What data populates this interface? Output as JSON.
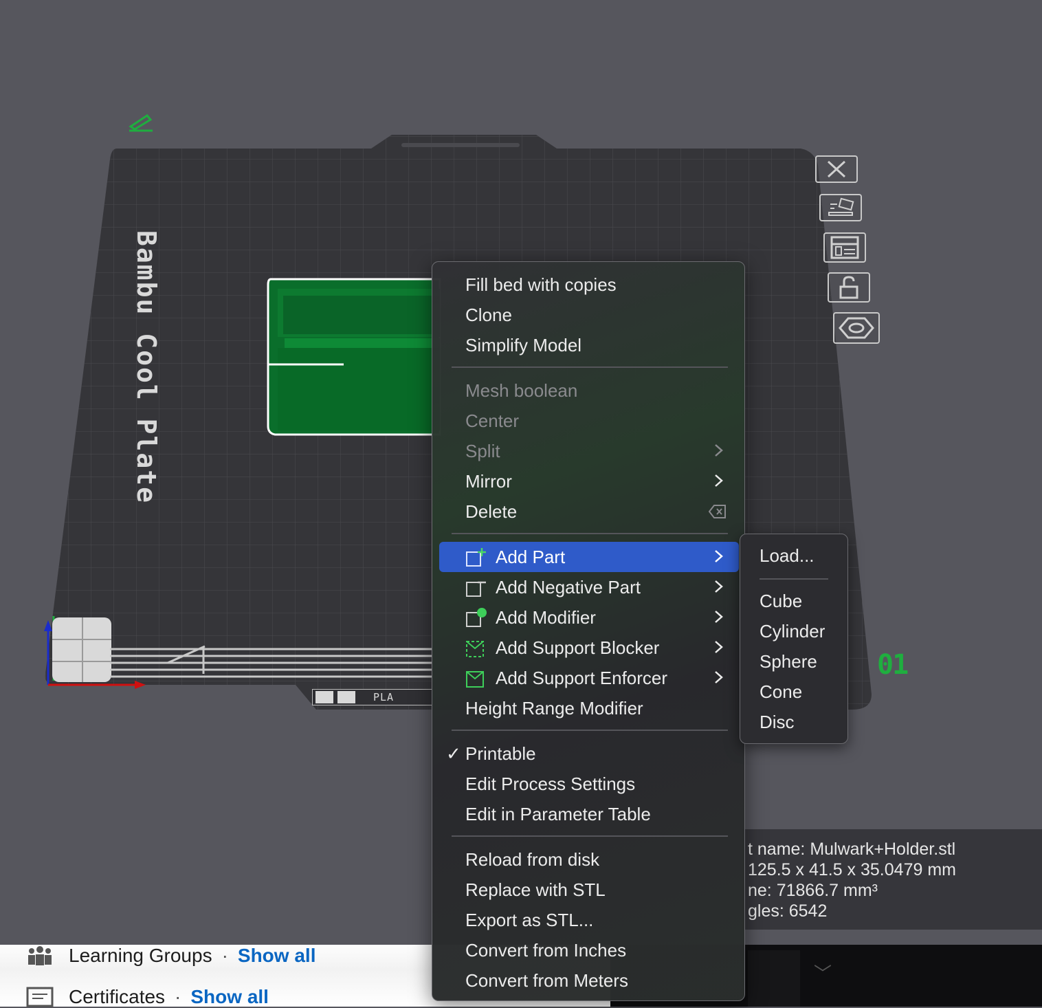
{
  "plate": {
    "label": "Bambu Cool Plate",
    "number": "01",
    "filament_tag": "PLA"
  },
  "info_panel": {
    "lines": [
      "t name: Mulwark+Holder.stl",
      "125.5 x 41.5 x 35.0479 mm",
      "ne: 71866.7 mm³",
      "gles: 6542"
    ]
  },
  "context_menu": {
    "items": [
      {
        "label": "Fill bed with copies"
      },
      {
        "label": "Clone"
      },
      {
        "label": "Simplify Model"
      },
      {
        "label": "Mesh boolean",
        "disabled": true
      },
      {
        "label": "Center",
        "disabled": true
      },
      {
        "label": "Split",
        "disabled": true,
        "submenu": true
      },
      {
        "label": "Mirror",
        "submenu": true
      },
      {
        "label": "Delete"
      },
      {
        "label": "Add Part",
        "submenu": true,
        "active": true
      },
      {
        "label": "Add Negative Part",
        "submenu": true
      },
      {
        "label": "Add Modifier",
        "submenu": true
      },
      {
        "label": "Add Support Blocker",
        "submenu": true
      },
      {
        "label": "Add Support Enforcer",
        "submenu": true
      },
      {
        "label": "Height Range Modifier"
      },
      {
        "label": "Printable",
        "checked": true
      },
      {
        "label": "Edit Process Settings"
      },
      {
        "label": "Edit in Parameter Table"
      },
      {
        "label": "Reload from disk"
      },
      {
        "label": "Replace with STL"
      },
      {
        "label": "Export as STL..."
      },
      {
        "label": "Convert from Inches"
      },
      {
        "label": "Convert from Meters"
      }
    ]
  },
  "submenu": {
    "items": [
      "Load...",
      "Cube",
      "Cylinder",
      "Sphere",
      "Cone",
      "Disc"
    ]
  },
  "background_page": {
    "learning_groups": "Learning Groups",
    "certificates": "Certificates",
    "separator": "·",
    "show_all": "Show all"
  },
  "icons": {
    "toolbar": [
      "close-icon",
      "auto-arrange-icon",
      "layout-icon",
      "lock-icon",
      "hexagon-eye-icon"
    ],
    "accent_green": "#1fae3f",
    "menu_active": "#2f5bc9"
  }
}
